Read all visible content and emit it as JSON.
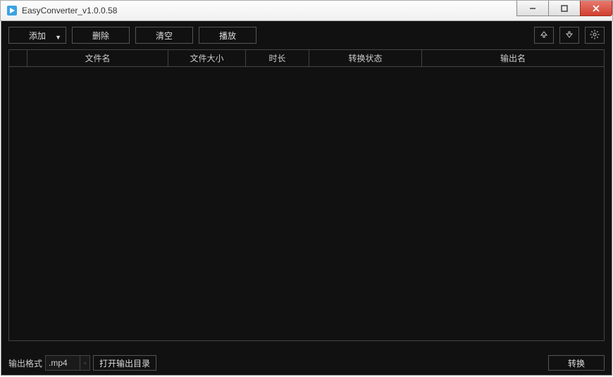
{
  "window": {
    "title": "EasyConverter_v1.0.0.58"
  },
  "toolbar": {
    "add": "添加",
    "delete": "删除",
    "clear": "清空",
    "play": "播放"
  },
  "table": {
    "headers": {
      "filename": "文件名",
      "filesize": "文件大小",
      "duration": "时长",
      "status": "转换状态",
      "output": "输出名"
    },
    "rows": []
  },
  "bottom": {
    "format_label": "输出格式",
    "format_value": ".mp4",
    "open_output_dir": "打开输出目录",
    "convert": "转换"
  }
}
